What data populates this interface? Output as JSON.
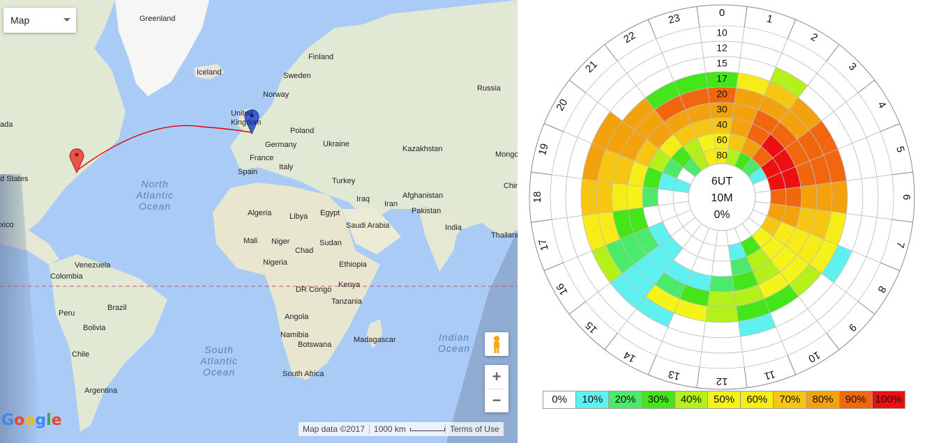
{
  "map": {
    "type_control": {
      "label": "Map"
    },
    "countries": [
      {
        "key": "greenland",
        "text": "Greenland"
      },
      {
        "key": "iceland",
        "text": "Iceland"
      },
      {
        "key": "finland",
        "text": "Finland"
      },
      {
        "key": "sweden",
        "text": "Sweden"
      },
      {
        "key": "norway",
        "text": "Norway"
      },
      {
        "key": "russia",
        "text": "Russia"
      },
      {
        "key": "uk",
        "text": "United Kingdom"
      },
      {
        "key": "poland",
        "text": "Poland"
      },
      {
        "key": "germany",
        "text": "Germany"
      },
      {
        "key": "ukraine",
        "text": "Ukraine"
      },
      {
        "key": "france",
        "text": "France"
      },
      {
        "key": "italy",
        "text": "Italy"
      },
      {
        "key": "spain",
        "text": "Spain"
      },
      {
        "key": "kazakhstan",
        "text": "Kazakhstan"
      },
      {
        "key": "mongolia",
        "text": "Mongolia"
      },
      {
        "key": "turkey",
        "text": "Turkey"
      },
      {
        "key": "iraq",
        "text": "Iraq"
      },
      {
        "key": "iran",
        "text": "Iran"
      },
      {
        "key": "afghanistan",
        "text": "Afghanistan"
      },
      {
        "key": "pakistan",
        "text": "Pakistan"
      },
      {
        "key": "china",
        "text": "China"
      },
      {
        "key": "india",
        "text": "India"
      },
      {
        "key": "thailand",
        "text": "Thailand"
      },
      {
        "key": "algeria",
        "text": "Algeria"
      },
      {
        "key": "libya",
        "text": "Libya"
      },
      {
        "key": "egypt",
        "text": "Egypt"
      },
      {
        "key": "saudi",
        "text": "Saudi Arabia"
      },
      {
        "key": "mali",
        "text": "Mali"
      },
      {
        "key": "niger",
        "text": "Niger"
      },
      {
        "key": "chad",
        "text": "Chad"
      },
      {
        "key": "sudan",
        "text": "Sudan"
      },
      {
        "key": "nigeria",
        "text": "Nigeria"
      },
      {
        "key": "ethiopia",
        "text": "Ethiopia"
      },
      {
        "key": "drc",
        "text": "DR Congo"
      },
      {
        "key": "kenya",
        "text": "Kenya"
      },
      {
        "key": "tanzania",
        "text": "Tanzania"
      },
      {
        "key": "angola",
        "text": "Angola"
      },
      {
        "key": "namibia",
        "text": "Namibia"
      },
      {
        "key": "botswana",
        "text": "Botswana"
      },
      {
        "key": "madagascar",
        "text": "Madagascar"
      },
      {
        "key": "southafrica",
        "text": "South Africa"
      },
      {
        "key": "venezuela",
        "text": "Venezuela"
      },
      {
        "key": "colombia",
        "text": "Colombia"
      },
      {
        "key": "brazil",
        "text": "Brazil"
      },
      {
        "key": "peru",
        "text": "Peru"
      },
      {
        "key": "bolivia",
        "text": "Bolivia"
      },
      {
        "key": "chile",
        "text": "Chile"
      },
      {
        "key": "argentina",
        "text": "Argentina"
      },
      {
        "key": "canada",
        "text": "ada"
      },
      {
        "key": "us",
        "text": "d States"
      },
      {
        "key": "mexico",
        "text": "xico"
      }
    ],
    "oceans": {
      "north_atlantic": [
        "North",
        "Atlantic",
        "Ocean"
      ],
      "south_atlantic": [
        "South",
        "Atlantic",
        "Ocean"
      ],
      "indian": [
        "Indian",
        "Ocean"
      ]
    },
    "attribution": {
      "data": "Map data ©2017",
      "scale": "1000 km",
      "terms": "Terms of Use"
    },
    "logo": "Google",
    "zoom_in": "+",
    "zoom_out": "−",
    "colors": {
      "path": "#e00000",
      "marker_origin": "#e8534a",
      "marker_dest": "#3a5fd9",
      "water": "#a9cbf5",
      "land": "#e9e5dc"
    }
  },
  "polar_chart": {
    "center_lines": [
      "6UT",
      "10M",
      "0%"
    ],
    "hours": [
      "0",
      "1",
      "2",
      "3",
      "4",
      "5",
      "6",
      "7",
      "8",
      "9",
      "10",
      "11",
      "12",
      "13",
      "14",
      "15",
      "16",
      "17",
      "18",
      "19",
      "20",
      "21",
      "22",
      "23"
    ],
    "ring_labels": [
      "80",
      "60",
      "40",
      "30",
      "20",
      "17",
      "15",
      "12",
      "10"
    ],
    "legend": [
      {
        "label": "0%",
        "color": "#ffffff"
      },
      {
        "label": "10%",
        "color": "#5ff0f0"
      },
      {
        "label": "20%",
        "color": "#4cea6a"
      },
      {
        "label": "30%",
        "color": "#44e61a"
      },
      {
        "label": "40%",
        "color": "#b4f01a"
      },
      {
        "label": "50%",
        "color": "#f4f41a"
      },
      {
        "label": "60%",
        "color": "#f8ec18"
      },
      {
        "label": "70%",
        "color": "#f6c612"
      },
      {
        "label": "80%",
        "color": "#f4a10e"
      },
      {
        "label": "90%",
        "color": "#f2660e"
      },
      {
        "label": "100%",
        "color": "#ee1010"
      }
    ]
  },
  "chart_data": {
    "type": "heatmap",
    "projection": "polar",
    "angular_axis": {
      "label_values": [
        "0",
        "1",
        "2",
        "3",
        "4",
        "5",
        "6",
        "7",
        "8",
        "9",
        "10",
        "11",
        "12",
        "13",
        "14",
        "15",
        "16",
        "17",
        "18",
        "19",
        "20",
        "21",
        "22",
        "23"
      ]
    },
    "radial_axis": {
      "rings_inner_to_outer": [
        "80",
        "60",
        "40",
        "30",
        "20",
        "17",
        "15",
        "12",
        "10"
      ]
    },
    "value_scale_percent": [
      0,
      10,
      20,
      30,
      40,
      50,
      60,
      70,
      80,
      90,
      100
    ],
    "values_percent": [
      [
        60,
        40,
        30,
        20,
        10,
        0,
        0,
        0,
        0,
        0,
        0,
        0,
        0,
        0,
        0,
        0,
        0,
        0,
        0,
        10,
        0,
        20,
        40,
        60
      ],
      [
        60,
        70,
        80,
        90,
        100,
        100,
        90,
        80,
        70,
        50,
        30,
        10,
        0,
        0,
        0,
        0,
        0,
        0,
        0,
        10,
        20,
        30,
        40,
        50
      ],
      [
        70,
        80,
        90,
        100,
        100,
        100,
        90,
        80,
        60,
        50,
        40,
        20,
        0,
        0,
        0,
        10,
        10,
        0,
        20,
        30,
        40,
        60,
        70,
        70
      ],
      [
        80,
        80,
        90,
        90,
        90,
        90,
        80,
        70,
        60,
        50,
        40,
        30,
        20,
        10,
        10,
        10,
        20,
        30,
        50,
        60,
        70,
        80,
        80,
        80
      ],
      [
        90,
        80,
        80,
        80,
        90,
        90,
        80,
        70,
        60,
        50,
        50,
        40,
        40,
        30,
        20,
        10,
        20,
        30,
        60,
        70,
        80,
        80,
        90,
        90
      ],
      [
        30,
        60,
        70,
        80,
        90,
        90,
        80,
        60,
        50,
        40,
        30,
        30,
        40,
        50,
        50,
        10,
        20,
        60,
        70,
        70,
        80,
        80,
        30,
        30
      ],
      [
        0,
        0,
        40,
        0,
        0,
        0,
        0,
        0,
        10,
        0,
        0,
        10,
        0,
        0,
        10,
        10,
        40,
        60,
        70,
        80,
        80,
        0,
        0,
        0
      ],
      [
        0,
        0,
        0,
        0,
        0,
        0,
        0,
        0,
        0,
        0,
        0,
        0,
        0,
        0,
        0,
        0,
        0,
        0,
        0,
        0,
        0,
        0,
        0,
        0
      ],
      [
        0,
        0,
        0,
        0,
        0,
        0,
        0,
        0,
        0,
        0,
        0,
        0,
        0,
        0,
        0,
        0,
        0,
        0,
        0,
        0,
        0,
        0,
        0,
        0
      ]
    ]
  }
}
